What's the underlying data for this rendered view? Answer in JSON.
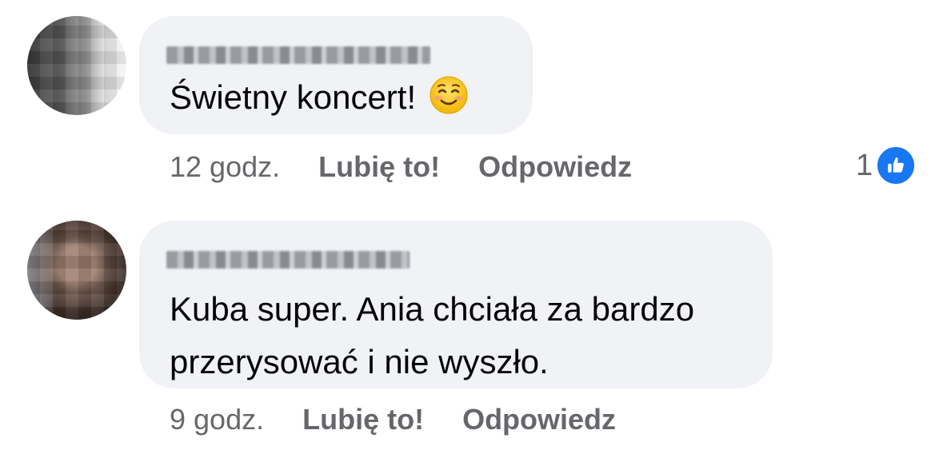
{
  "comments": [
    {
      "author": "",
      "text": "Świetny koncert!",
      "emoji": "smiling-face-emoji",
      "time": "12 godz.",
      "like_label": "Lubię to!",
      "reply_label": "Odpowiedz",
      "reaction_count": "1"
    },
    {
      "author": "",
      "text_line1": "Kuba super. Ania chciała za bardzo",
      "text_line2": "przerysować i nie wyszło.",
      "time": "9 godz.",
      "like_label": "Lubię to!",
      "reply_label": "Odpowiedz"
    }
  ],
  "colors": {
    "bubble": "#f0f2f5",
    "meta_text": "#65676b",
    "like_blue": "#1877f2"
  }
}
